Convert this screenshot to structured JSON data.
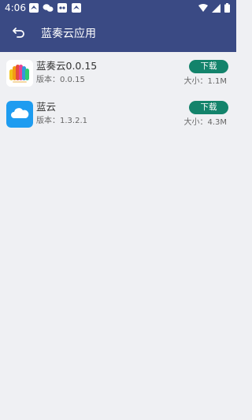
{
  "status_bar": {
    "time": "4:06",
    "icons": [
      "feishu-icon",
      "wechat-icon",
      "game-icon",
      "feishu-icon"
    ]
  },
  "app_bar": {
    "title": "蓝奏云应用"
  },
  "apps": [
    {
      "name": "蓝奏云0.0.15",
      "version": "版本：0.0.15",
      "size": "大小：1.1M",
      "download_label": "下载"
    },
    {
      "name": "蓝云",
      "version": "版本：1.3.2.1",
      "size": "大小：4.3M",
      "download_label": "下载"
    }
  ],
  "colors": {
    "header": "#3a4a84",
    "accent": "#13836b",
    "background": "#eff0f3"
  }
}
